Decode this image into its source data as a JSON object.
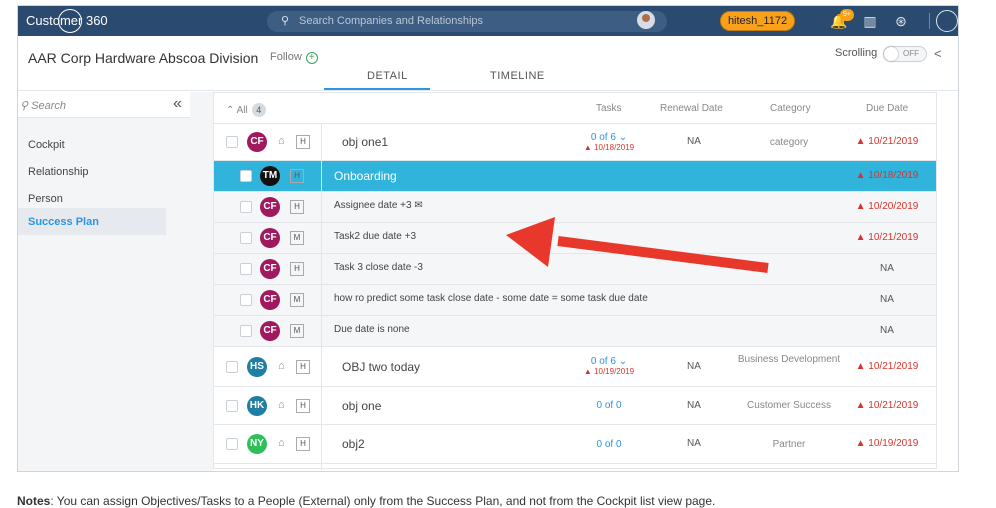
{
  "app": {
    "title": "Customer 360",
    "search_placeholder": "Search Companies and Relationships",
    "user": "hitesh_1172",
    "notif_count": "9+"
  },
  "header": {
    "company": "AAR Corp Hardware Abscoa Division",
    "follow": "Follow",
    "tabs": [
      "DETAIL",
      "TIMELINE"
    ],
    "scrolling_label": "Scrolling",
    "toggle_state": "OFF"
  },
  "sidebar": {
    "search_placeholder": "Search",
    "items": [
      "Cockpit",
      "Relationship",
      "Person",
      "Success Plan"
    ],
    "active": "Success Plan"
  },
  "grid": {
    "headers": {
      "all": "All",
      "count": "4",
      "tasks": "Tasks",
      "renewal": "Renewal Date",
      "category": "Category",
      "due": "Due Date"
    },
    "rows": [
      {
        "avatar": "CF",
        "color": "#a0195e",
        "flag": "H",
        "name": "obj one1",
        "tasks": "0 of 6",
        "task_date": "10/18/2019",
        "renewal": "NA",
        "category": "category",
        "due": "10/21/2019"
      },
      {
        "avatar": "TM",
        "color": "#111111",
        "flag": "H",
        "name": "Onboarding",
        "due": "10/18/2019"
      },
      {
        "avatar": "CF",
        "color": "#a0195e",
        "flag": "H",
        "name": "Assignee date +3",
        "due": "10/20/2019"
      },
      {
        "avatar": "CF",
        "color": "#a0195e",
        "flag": "M",
        "name": "Task2 due date +3",
        "due": "10/21/2019"
      },
      {
        "avatar": "CF",
        "color": "#a0195e",
        "flag": "H",
        "name": "Task 3 close date -3",
        "due": "NA"
      },
      {
        "avatar": "CF",
        "color": "#a0195e",
        "flag": "M",
        "name": "how ro predict some task close date - some date = some task due date",
        "due": "NA"
      },
      {
        "avatar": "CF",
        "color": "#a0195e",
        "flag": "M",
        "name": "Due date is none",
        "due": "NA"
      },
      {
        "avatar": "HS",
        "color": "#1e7fa3",
        "flag": "H",
        "name": "OBJ two today",
        "tasks": "0 of 6",
        "task_date": "10/19/2019",
        "renewal": "NA",
        "category": "Business Development",
        "due": "10/21/2019"
      },
      {
        "avatar": "HK",
        "color": "#1e7fa3",
        "flag": "H",
        "name": "obj one",
        "tasks": "0 of 0",
        "renewal": "NA",
        "category": "Customer Success",
        "due": "10/21/2019"
      },
      {
        "avatar": "NY",
        "color": "#2fbf5a",
        "flag": "H",
        "name": "obj2",
        "tasks": "0 of 0",
        "renewal": "NA",
        "category": "Partner",
        "due": "10/19/2019"
      }
    ]
  },
  "note": {
    "label": "Notes",
    "text": ": You can assign Objectives/Tasks to a People (External) only from the Success Plan, and not from the Cockpit list view page."
  }
}
